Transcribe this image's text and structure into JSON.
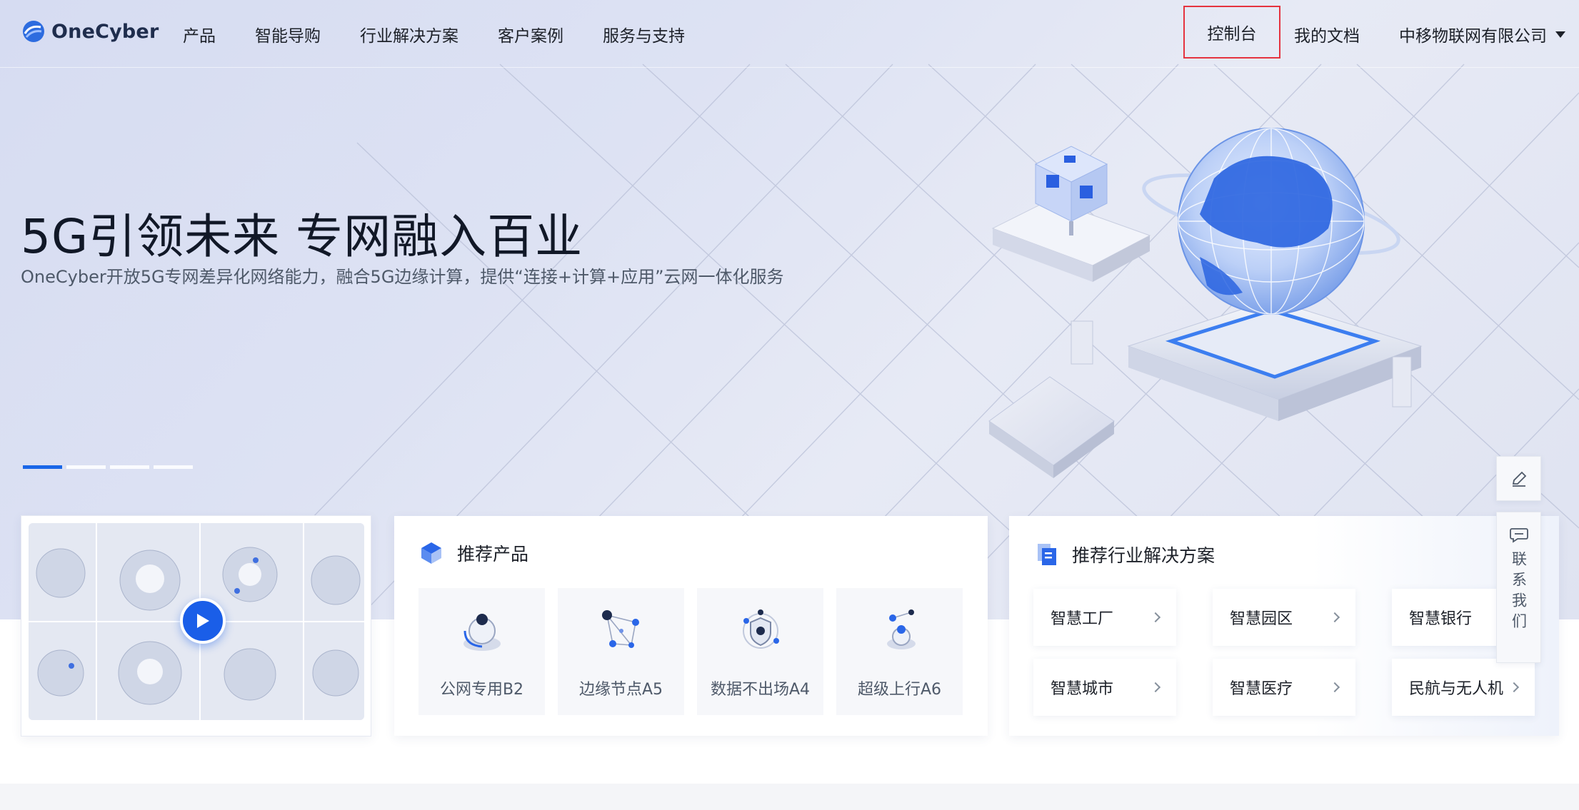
{
  "nav": {
    "logo_text": "OneCyber",
    "links": [
      "产品",
      "智能导购",
      "行业解决方案",
      "客户案例",
      "服务与支持"
    ],
    "console_label": "控制台",
    "docs_label": "我的文档",
    "company_label": "中移物联网有限公司"
  },
  "hero": {
    "title": "5G引领未来 专网融入百业",
    "subtitle": "OneCyber开放5G专网差异化网络能力，融合5G边缘计算，提供“连接+计算+应用”云网一体化服务",
    "active_slide": 1,
    "slide_count": 4
  },
  "products": {
    "title": "推荐产品",
    "items": [
      {
        "label": "公网专用B2",
        "icon": "camera-device-icon"
      },
      {
        "label": "边缘节点A5",
        "icon": "node-network-icon"
      },
      {
        "label": "数据不出场A4",
        "icon": "data-shield-icon"
      },
      {
        "label": "超级上行A6",
        "icon": "upload-orb-icon"
      }
    ]
  },
  "solutions": {
    "title": "推荐行业解决方案",
    "items": [
      {
        "label": "智慧工厂"
      },
      {
        "label": "智慧园区"
      },
      {
        "label": "智慧银行"
      },
      {
        "label": "智慧城市"
      },
      {
        "label": "智慧医疗"
      },
      {
        "label": "民航与无人机"
      }
    ]
  },
  "floating": {
    "contact_label": "联系我们"
  },
  "colors": {
    "accent": "#1a66e8",
    "highlight_border": "#e5333f"
  }
}
